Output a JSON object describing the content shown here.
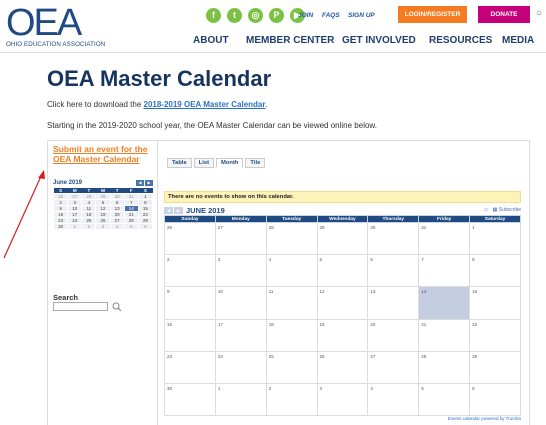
{
  "header": {
    "logo_mark": "OEA",
    "logo_sub": "OHIO EDUCATION ASSOCIATION",
    "social": [
      "f",
      "t",
      "◎",
      "P",
      "▶"
    ],
    "links": [
      "JOIN",
      "FAQS",
      "SIGN UP"
    ],
    "login": "LOGIN/REGISTER",
    "donate": "DONATE",
    "nav": [
      "ABOUT",
      "MEMBER CENTER",
      "GET INVOLVED",
      "RESOURCES",
      "MEDIA"
    ],
    "colors": {
      "brand": "#1f4a82",
      "green": "#7cc242",
      "orange": "#f47b20",
      "magenta": "#c5007a"
    }
  },
  "page": {
    "title": "OEA Master Calendar",
    "download_prefix": "Click here to download the ",
    "download_link": "2018-2019  OEA Master Calendar",
    "download_suffix": ".",
    "info": "Starting in the 2019-2020 school year, the OEA Master Calendar can be viewed online below."
  },
  "sidebar": {
    "submit": "Submit an event for the OEA Master Calendar",
    "mini_title": "June 2019",
    "mini_days": [
      "S",
      "M",
      "T",
      "W",
      "T",
      "F",
      "S"
    ],
    "mini_weeks": [
      [
        "26",
        "27",
        "28",
        "29",
        "30",
        "31",
        "1"
      ],
      [
        "2",
        "3",
        "4",
        "5",
        "6",
        "7",
        "8"
      ],
      [
        "9",
        "10",
        "11",
        "12",
        "13",
        "14",
        "15"
      ],
      [
        "16",
        "17",
        "18",
        "19",
        "20",
        "21",
        "22"
      ],
      [
        "23",
        "24",
        "25",
        "26",
        "27",
        "28",
        "29"
      ],
      [
        "30",
        "1",
        "2",
        "3",
        "4",
        "5",
        "6"
      ]
    ],
    "search_label": "Search"
  },
  "calendar": {
    "tabs": [
      "Table",
      "List",
      "Month",
      "Tile"
    ],
    "active_tab": "Month",
    "notice": "There are no events to show on this calendar.",
    "month": "JUNE 2019",
    "tools": [
      "Subscribe"
    ],
    "days": [
      "Sunday",
      "Monday",
      "Tuesday",
      "Wednesday",
      "Thursday",
      "Friday",
      "Saturday"
    ],
    "weeks": [
      [
        "26",
        "27",
        "28",
        "29",
        "30",
        "31",
        "1"
      ],
      [
        "2",
        "3",
        "4",
        "5",
        "6",
        "7",
        "8"
      ],
      [
        "9",
        "10",
        "11",
        "12",
        "13",
        "14",
        "15"
      ],
      [
        "16",
        "17",
        "18",
        "19",
        "20",
        "21",
        "22"
      ],
      [
        "23",
        "24",
        "25",
        "26",
        "27",
        "28",
        "29"
      ],
      [
        "30",
        "1",
        "2",
        "3",
        "4",
        "5",
        "6"
      ]
    ],
    "today": "14",
    "powered": "Events calendar powered by Trumba"
  }
}
